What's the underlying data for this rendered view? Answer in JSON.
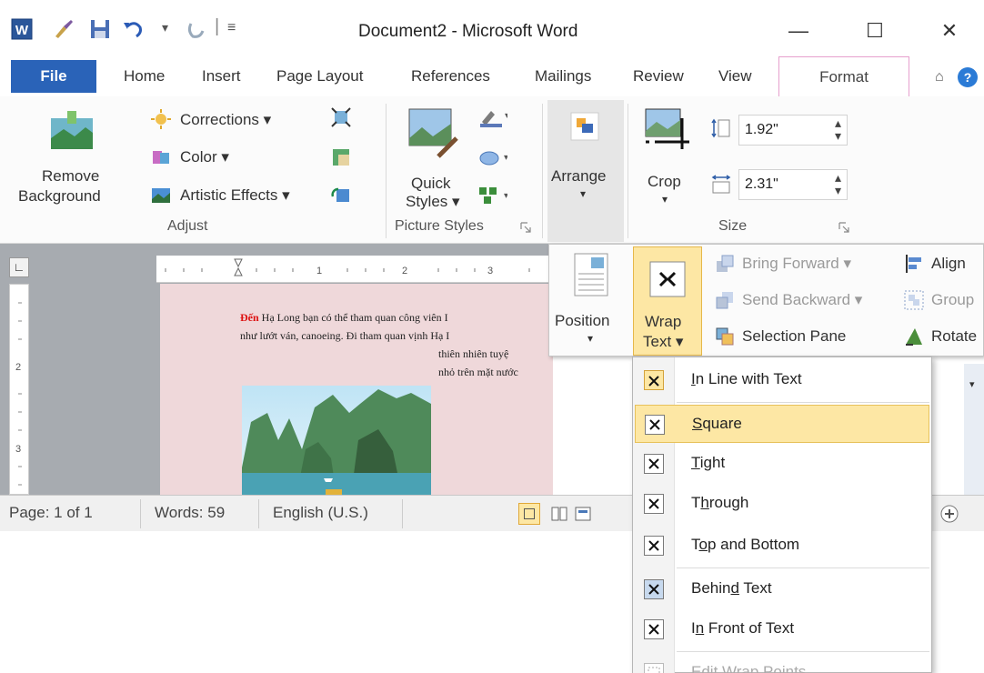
{
  "window": {
    "title": "Document2 - Microsoft Word",
    "minimize": "—",
    "maximize": "☐",
    "close": "✕"
  },
  "ribbon_tabs": {
    "file": "File",
    "home": "Home",
    "insert": "Insert",
    "page_layout": "Page Layout",
    "references": "References",
    "mailings": "Mailings",
    "review": "Review",
    "view": "View",
    "format": "Format"
  },
  "adjust": {
    "remove_bg_1": "Remove",
    "remove_bg_2": "Background",
    "corrections": "Corrections ▾",
    "color": "Color ▾",
    "artistic": "Artistic Effects ▾",
    "group_label": "Adjust"
  },
  "picture_styles": {
    "quick_1": "Quick",
    "quick_2": "Styles ▾",
    "group_label": "Picture Styles"
  },
  "arrange": {
    "label": "Arrange",
    "arrow": "▾"
  },
  "size": {
    "crop": "Crop",
    "crop_arrow": "▾",
    "height": "1.92\"",
    "width": "2.31\"",
    "group_label": "Size"
  },
  "arrange_panel": {
    "position": "Position",
    "position_arrow": "▾",
    "wrap_1": "Wrap",
    "wrap_2": "Text ▾",
    "bring_forward": "Bring Forward ▾",
    "send_backward": "Send Backward ▾",
    "selection_pane": "Selection Pane",
    "align": "Align",
    "group": "Group",
    "rotate": "Rotate"
  },
  "document": {
    "line1_first": "Đến",
    "line1_rest": " Hạ Long bạn có thể tham quan công viên I",
    "line2": "như lướt ván, canoeing. Đi tham quan vịnh Hạ I",
    "line3": "thiên nhiên tuyệ",
    "line4": "nhỏ trên mặt nước"
  },
  "status_bar": {
    "page": "Page: 1 of 1",
    "words": "Words: 59",
    "language": "English (U.S.)"
  },
  "wrap_menu": {
    "items": [
      {
        "pre": "",
        "u": "I",
        "post": "n Line with Text"
      },
      {
        "pre": "",
        "u": "S",
        "post": "quare"
      },
      {
        "pre": "",
        "u": "T",
        "post": "ight"
      },
      {
        "pre": "T",
        "u": "h",
        "post": "rough"
      },
      {
        "pre": "T",
        "u": "o",
        "post": "p and Bottom"
      },
      {
        "pre": "Behin",
        "u": "d",
        "post": " Text"
      },
      {
        "pre": "I",
        "u": "n",
        "post": " Front of Text"
      },
      {
        "pre": "",
        "u": "",
        "post": "Edit Wrap Points"
      }
    ],
    "selected_index": 1
  },
  "colors": {
    "file_tab": "#2a63b8",
    "format_tab_border": "#e6a0ce",
    "highlight": "#fde7a4",
    "page_bg": "#efd8da"
  }
}
